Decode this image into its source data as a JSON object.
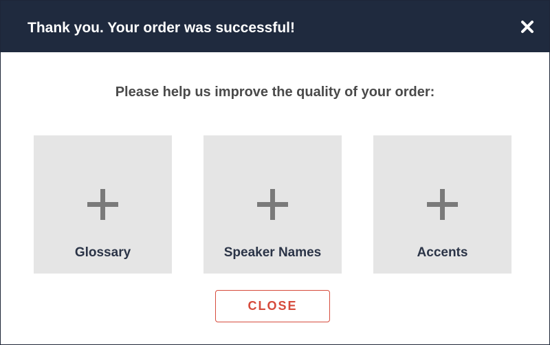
{
  "header": {
    "title": "Thank you. Your order was successful!",
    "close_icon": "close-icon"
  },
  "prompt": "Please help us improve the quality of your order:",
  "cards": [
    {
      "label": "Glossary",
      "icon": "plus-icon"
    },
    {
      "label": "Speaker Names",
      "icon": "plus-icon"
    },
    {
      "label": "Accents",
      "icon": "plus-icon"
    }
  ],
  "close_button": {
    "label": "CLOSE"
  },
  "colors": {
    "header_bg": "#1f2a3e",
    "card_bg": "#e5e5e5",
    "accent": "#d64a3b",
    "plus_icon": "#7a7a7a",
    "card_text": "#2b3447"
  }
}
